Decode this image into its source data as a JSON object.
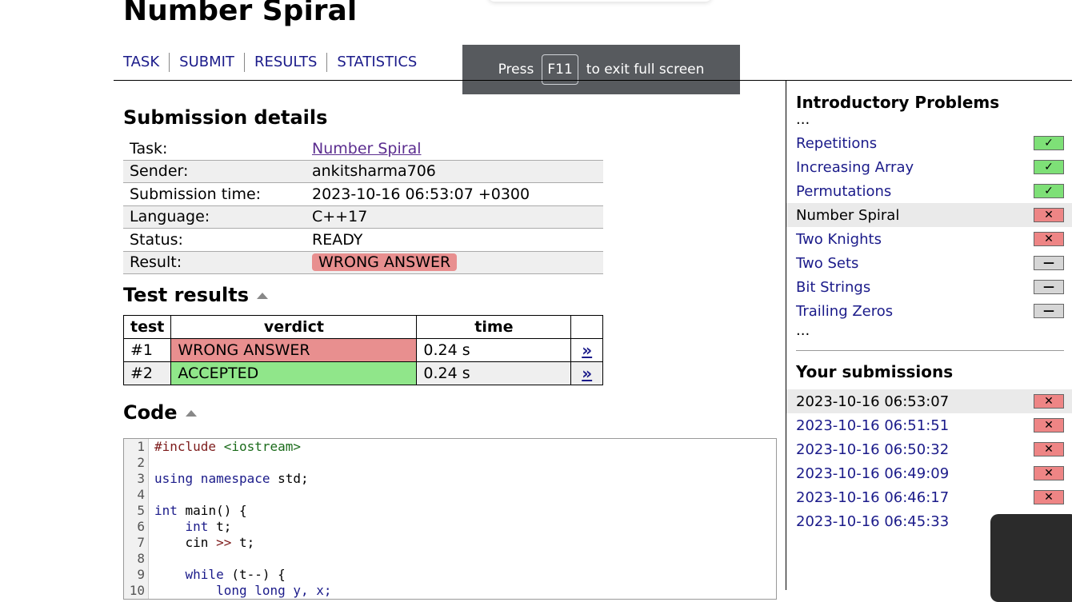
{
  "page": {
    "title": "Number Spiral"
  },
  "nav": [
    "TASK",
    "SUBMIT",
    "RESULTS",
    "STATISTICS"
  ],
  "fullscreen_toast": {
    "press": "Press",
    "key": "F11",
    "rest": "to exit full screen"
  },
  "submission": {
    "heading": "Submission details",
    "rows": [
      {
        "key": "Task:",
        "value": "Number Spiral"
      },
      {
        "key": "Sender:",
        "value": "ankitsharma706"
      },
      {
        "key": "Submission time:",
        "value": "2023-10-16 06:53:07 +0300"
      },
      {
        "key": "Language:",
        "value": "C++17"
      },
      {
        "key": "Status:",
        "value": "READY"
      },
      {
        "key": "Result:",
        "value": "WRONG ANSWER"
      }
    ]
  },
  "tests": {
    "heading": "Test results",
    "columns": [
      "test",
      "verdict",
      "time",
      ""
    ],
    "rows": [
      {
        "test": "#1",
        "verdict": "WRONG ANSWER",
        "time": "0.24 s",
        "link": "»"
      },
      {
        "test": "#2",
        "verdict": "ACCEPTED",
        "time": "0.24 s",
        "link": "»"
      }
    ]
  },
  "code": {
    "heading": "Code",
    "lines": [
      "1",
      "2",
      "3",
      "4",
      "5",
      "6",
      "7",
      "8",
      "9",
      "10"
    ],
    "text": {
      "l1a": "#include",
      "l1b": " <iostream>",
      "l3a": "using",
      "l3b": " namespace",
      "l3c": " std;",
      "l5a": "int",
      "l5b": " main() {",
      "l6a": "    int",
      "l6b": " t;",
      "l7a": "    cin",
      "l7b": " >>",
      "l7c": " t;",
      "l9a": "    while",
      "l9b": " (t--) {",
      "l10": "        long long y, x;"
    }
  },
  "sidebar": {
    "problems_heading": "Introductory Problems",
    "dots": "...",
    "problems": [
      {
        "label": "Repetitions",
        "status": "ok",
        "icon": "check-icon"
      },
      {
        "label": "Increasing Array",
        "status": "ok",
        "icon": "check-icon"
      },
      {
        "label": "Permutations",
        "status": "ok",
        "icon": "check-icon"
      },
      {
        "label": "Number Spiral",
        "status": "bad",
        "icon": "cross-icon"
      },
      {
        "label": "Two Knights",
        "status": "bad",
        "icon": "cross-icon"
      },
      {
        "label": "Two Sets",
        "status": "none",
        "icon": "dash-icon"
      },
      {
        "label": "Bit Strings",
        "status": "none",
        "icon": "dash-icon"
      },
      {
        "label": "Trailing Zeros",
        "status": "none",
        "icon": "dash-icon"
      }
    ],
    "submissions_heading": "Your submissions",
    "submissions": [
      {
        "time": "2023-10-16 06:53:07",
        "status": "bad"
      },
      {
        "time": "2023-10-16 06:51:51",
        "status": "bad"
      },
      {
        "time": "2023-10-16 06:50:32",
        "status": "bad"
      },
      {
        "time": "2023-10-16 06:49:09",
        "status": "bad"
      },
      {
        "time": "2023-10-16 06:46:17",
        "status": "bad"
      },
      {
        "time": "2023-10-16 06:45:33",
        "status": "bad"
      }
    ]
  },
  "colors": {
    "wrong": "#e88f8f",
    "accepted": "#90e68a",
    "link": "#1b1b8a"
  }
}
